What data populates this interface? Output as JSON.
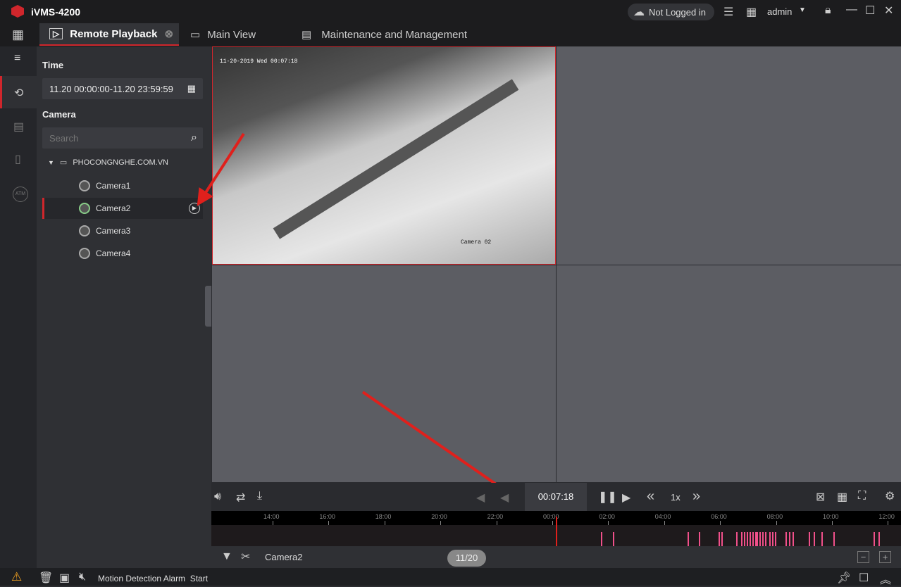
{
  "app": {
    "title": "iVMS-4200",
    "login_status": "Not Logged in",
    "user": "admin"
  },
  "tabs": [
    {
      "label": "Remote Playback",
      "active": true
    },
    {
      "label": "Main View"
    },
    {
      "label": "Maintenance and Management"
    }
  ],
  "panel": {
    "time_label": "Time",
    "time_range": "11.20 00:00:00-11.20 23:59:59",
    "camera_label": "Camera",
    "search_placeholder": "Search",
    "group": "PHOCONGNGHE.COM.VN",
    "cameras": [
      {
        "name": "Camera1"
      },
      {
        "name": "Camera2",
        "selected": true
      },
      {
        "name": "Camera3"
      },
      {
        "name": "Camera4"
      }
    ]
  },
  "video": {
    "osd_time": "11-20-2019 Wed 00:07:18",
    "osd_name": "Camera 02"
  },
  "controls": {
    "current_time": "00:07:18",
    "speed": "1x"
  },
  "timeline": {
    "ticks": [
      "14:00",
      "16:00",
      "18:00",
      "20:00",
      "22:00",
      "00:00",
      "02:00",
      "04:00",
      "06:00",
      "08:00",
      "10:00",
      "12:00"
    ],
    "camera": "Camera2",
    "date": "11/20",
    "cursor": "00:07:18",
    "record_hours_after_midnight": [
      1.74,
      2.17,
      4.84,
      5.24,
      5.94,
      6.05,
      6.57,
      6.75,
      6.85,
      6.95,
      7.05,
      7.15,
      7.25,
      7.3,
      7.4,
      7.5,
      7.6,
      7.75,
      7.85,
      7.96,
      8.34,
      8.46,
      8.59,
      9.17,
      9.35,
      9.62,
      10.05,
      11.49,
      11.66
    ],
    "record_color": "#f0508a"
  },
  "status": {
    "message": "Motion Detection Alarm  Start"
  },
  "colors": {
    "accent": "#d0262c"
  }
}
